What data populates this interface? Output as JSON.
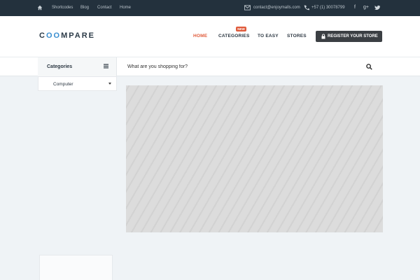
{
  "topbar": {
    "nav": [
      "Shortcodes",
      "Blog",
      "Contact",
      "Home"
    ],
    "email": "contact@enjoymalls.com",
    "phone": "+57 (1) 30078799"
  },
  "header": {
    "logo": {
      "prefix": "C",
      "middle": "OO",
      "suffix": "MPARE"
    },
    "menu": [
      {
        "label": "HOME"
      },
      {
        "label": "CATEGORIES",
        "badge": "NEW"
      },
      {
        "label": "TO EASY"
      },
      {
        "label": "STORES"
      }
    ],
    "register_label": "REGISTER YOUR STORE"
  },
  "categories": {
    "title": "Categories",
    "selected": "Computer"
  },
  "search": {
    "placeholder": "What are you shopping for?"
  },
  "colors": {
    "topbar": "#23313d",
    "accent": "#e05a3a",
    "logo_accent": "#3a8fd0",
    "button": "#3b3f43"
  }
}
